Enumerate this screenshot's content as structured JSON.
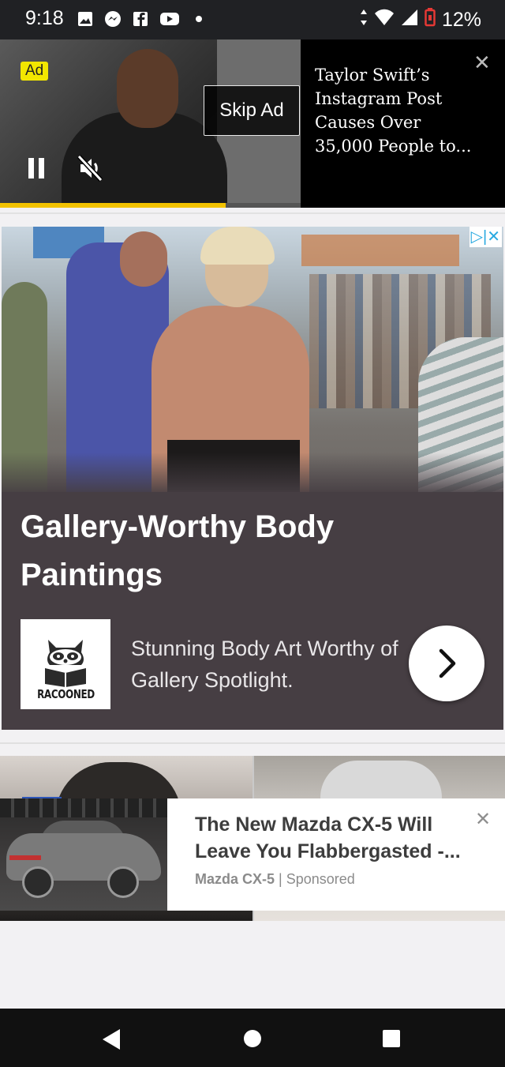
{
  "status_bar": {
    "time": "9:18",
    "notification_icons": [
      "image-icon",
      "messenger-icon",
      "facebook-icon",
      "youtube-icon",
      "dot-icon"
    ],
    "battery": "12%"
  },
  "video_ad": {
    "ad_label": "Ad",
    "skip_label": "Skip Ad",
    "headline": "Taylor Swift’s Instagram Post Causes Over 35,000 People to...",
    "close_symbol": "✕",
    "progress_fraction": 0.75
  },
  "gallery_ad": {
    "title": "Gallery-Worthy Body Paintings",
    "brand": "RACOONED",
    "description": "Stunning Body Art Worthy of Gallery Spotlight.",
    "adchoices_symbol": "▷|✕"
  },
  "mazda_ad": {
    "title": "The New Mazda CX-5 Will Leave You Flabbergasted -...",
    "source": "Mazda CX-5",
    "separator": "|",
    "sponsored": "Sponsored",
    "close_symbol": "✕"
  },
  "colors": {
    "ad_chip": "#f2e600",
    "progress": "#f2c200",
    "gallery_bg": "#463e43",
    "adchoices": "#29a9e0"
  }
}
